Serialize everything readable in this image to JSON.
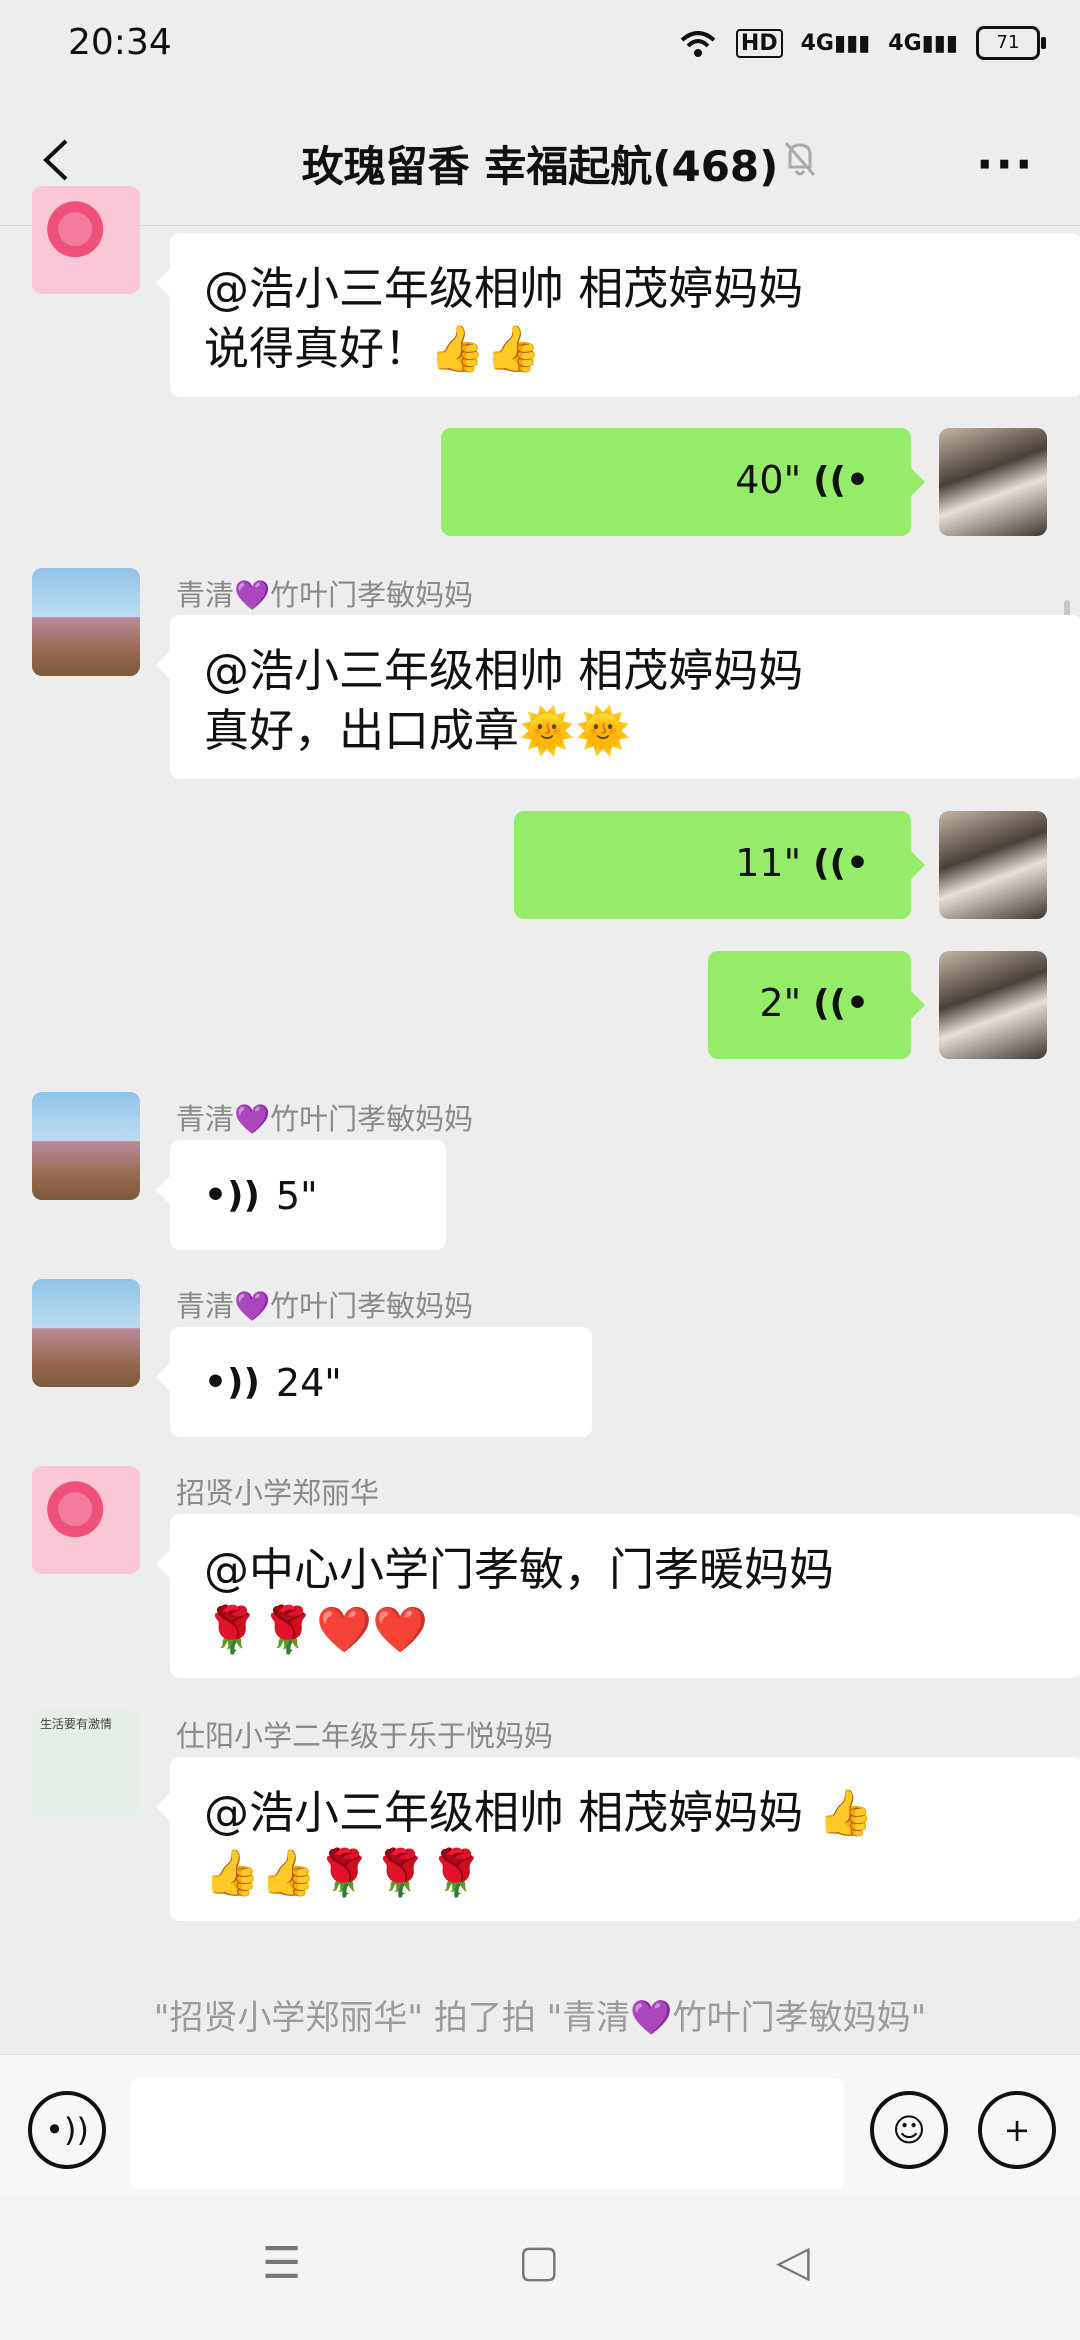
{
  "status_bar": {
    "time": "20:34",
    "hd": "HD",
    "net1": "4G",
    "net2": "4G",
    "battery": "71"
  },
  "header": {
    "title": "玫瑰留香  幸福起航(468)",
    "more": "···"
  },
  "messages": [
    {
      "text_line1": "@浩小三年级相帅  相茂婷妈妈",
      "text_line2": "说得真好！👍👍"
    },
    {
      "duration": "40\""
    },
    {
      "sender": "青清💜竹叶门孝敏妈妈",
      "text_line1": "@浩小三年级相帅  相茂婷妈妈",
      "text_line2": "真好，出口成章🌞🌞"
    },
    {
      "duration": "11\""
    },
    {
      "duration": "2\""
    },
    {
      "sender": "青清💜竹叶门孝敏妈妈",
      "duration": "5\""
    },
    {
      "sender": "青清💜竹叶门孝敏妈妈",
      "duration": "24\""
    },
    {
      "sender": "招贤小学郑丽华",
      "text_line1": "@中心小学门孝敏，门孝暖妈妈",
      "text_line2": "🌹🌹❤️❤️"
    },
    {
      "sender": "仕阳小学二年级于乐于悦妈妈",
      "text_line1": "@浩小三年级相帅  相茂婷妈妈  👍",
      "text_line2": "👍👍🌹🌹🌹"
    }
  ],
  "avatar_caption": "生活要有激情",
  "system_note": "\"招贤小学郑丽华\" 拍了拍 \"青清💜竹叶门孝敏妈妈\"",
  "input": {
    "placeholder": ""
  },
  "colors": {
    "self_bubble": "#95ec69",
    "other_bubble": "#ffffff",
    "background": "#ededed"
  },
  "icons": [
    "signal-icon",
    "wifi-icon",
    "mute-bell-icon",
    "voice-icon",
    "emoji-icon",
    "plus-icon"
  ]
}
